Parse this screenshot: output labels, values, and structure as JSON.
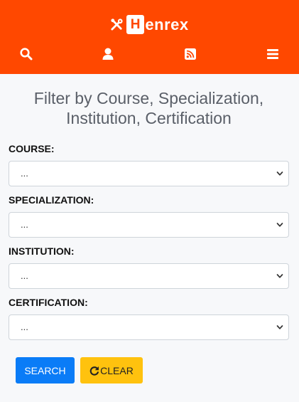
{
  "app": {
    "brand_prefix": "H",
    "brand_rest": "enrex"
  },
  "nav": {
    "icons": [
      "search-icon",
      "user-icon",
      "rss-icon",
      "menu-icon"
    ]
  },
  "main": {
    "title_line1": "Filter by Course, Specialization,",
    "title_line2": "Institution, Certification",
    "filters": [
      {
        "label": "COURSE:",
        "selected": "..."
      },
      {
        "label": "SPECIALIZATION:",
        "selected": "..."
      },
      {
        "label": "INSTITUTION:",
        "selected": "..."
      },
      {
        "label": "CERTIFICATION:",
        "selected": "..."
      }
    ]
  },
  "actions": {
    "search_label": "SEARCH",
    "clear_label": "CLEAR"
  },
  "colors": {
    "header": "#ff4800",
    "search_button": "#0a7cf7",
    "clear_button": "#ffc20e",
    "title_text": "#5a5f68"
  }
}
